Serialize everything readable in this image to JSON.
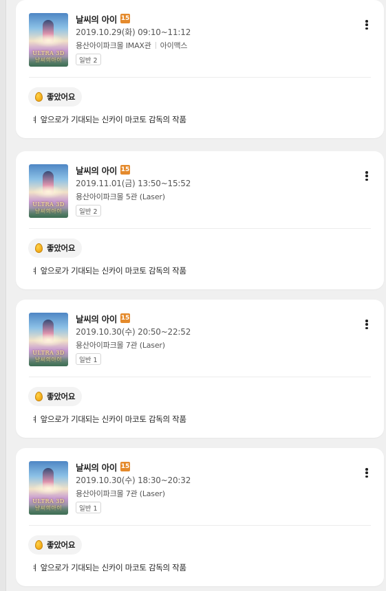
{
  "cards": [
    {
      "title": "날씨의 아이",
      "age_rating": "15",
      "showtime": "2019.11.01(금) 13:50~15:52",
      "theater": "용산아이파크몰 5관 (Laser)",
      "theater_extra": "",
      "ticket": "일반 2",
      "poster_caption": "ULTRA 3D 날씨의아이",
      "reaction": "좋았어요",
      "review": "ㅕ 앞으로가 기대되는 신카이 마코토 감독의 작품"
    },
    {
      "title": "날씨의 아이",
      "age_rating": "15",
      "showtime": "2019.10.30(수) 20:50~22:52",
      "theater": "용산아이파크몰 7관 (Laser)",
      "theater_extra": "",
      "ticket": "일반 1",
      "poster_caption": "ULTRA 3D 날씨의아이",
      "reaction": "좋았어요",
      "review": "ㅕ 앞으로가 기대되는 신카이 마코토 감독의 작품"
    },
    {
      "title": "날씨의 아이",
      "age_rating": "15",
      "showtime": "2019.10.30(수) 18:30~20:32",
      "theater": "용산아이파크몰 7관 (Laser)",
      "theater_extra": "",
      "ticket": "일반 1",
      "poster_caption": "ULTRA 3D 날씨의아이",
      "reaction": "좋았어요",
      "review": "ㅕ 앞으로가 기대되는 신카이 마코토 감독의 작품"
    },
    {
      "title": "날씨의 아이",
      "age_rating": "15",
      "showtime": "2019.10.29(화) 09:10~11:12",
      "theater": "용산아이파크몰 IMAX관",
      "theater_extra": "아이맥스",
      "ticket": "일반 2",
      "poster_caption": "ULTRA 3D 날씨의아이",
      "reaction": "좋았어요",
      "review": "ㅕ 앞으로가 기대되는 신카이 마코토 감독의 작품"
    }
  ],
  "icons": {
    "more": "more-vertical-icon",
    "reaction": "golden-egg-icon"
  },
  "colors": {
    "background": "#f0f0f0",
    "card": "#ffffff",
    "age_badge": "#e48a2c",
    "egg": "#f2aa16"
  }
}
